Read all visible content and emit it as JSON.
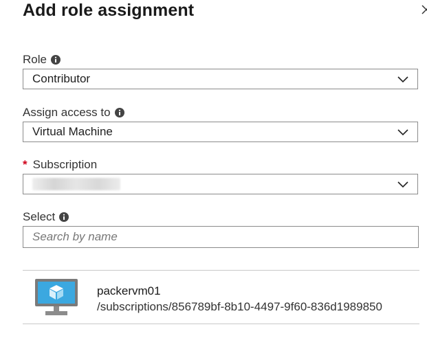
{
  "blade": {
    "title": "Add role assignment"
  },
  "role": {
    "label": "Role",
    "value": "Contributor"
  },
  "assign_access": {
    "label": "Assign access to",
    "value": "Virtual Machine"
  },
  "subscription": {
    "required_mark": "*",
    "label": "Subscription"
  },
  "select": {
    "label": "Select",
    "placeholder": "Search by name"
  },
  "results": [
    {
      "icon": "virtual-machine-icon",
      "name": "packervm01",
      "path": "/subscriptions/856789bf-8b10-4497-9f60-836d1989850"
    }
  ],
  "icons": {
    "info": "info-icon",
    "dropdown": "chevron-down-icon",
    "close": "close-icon"
  },
  "colors": {
    "required": "#d0021b",
    "vm_screen": "#3ba8e0",
    "vm_frame": "#7a7a7a"
  }
}
